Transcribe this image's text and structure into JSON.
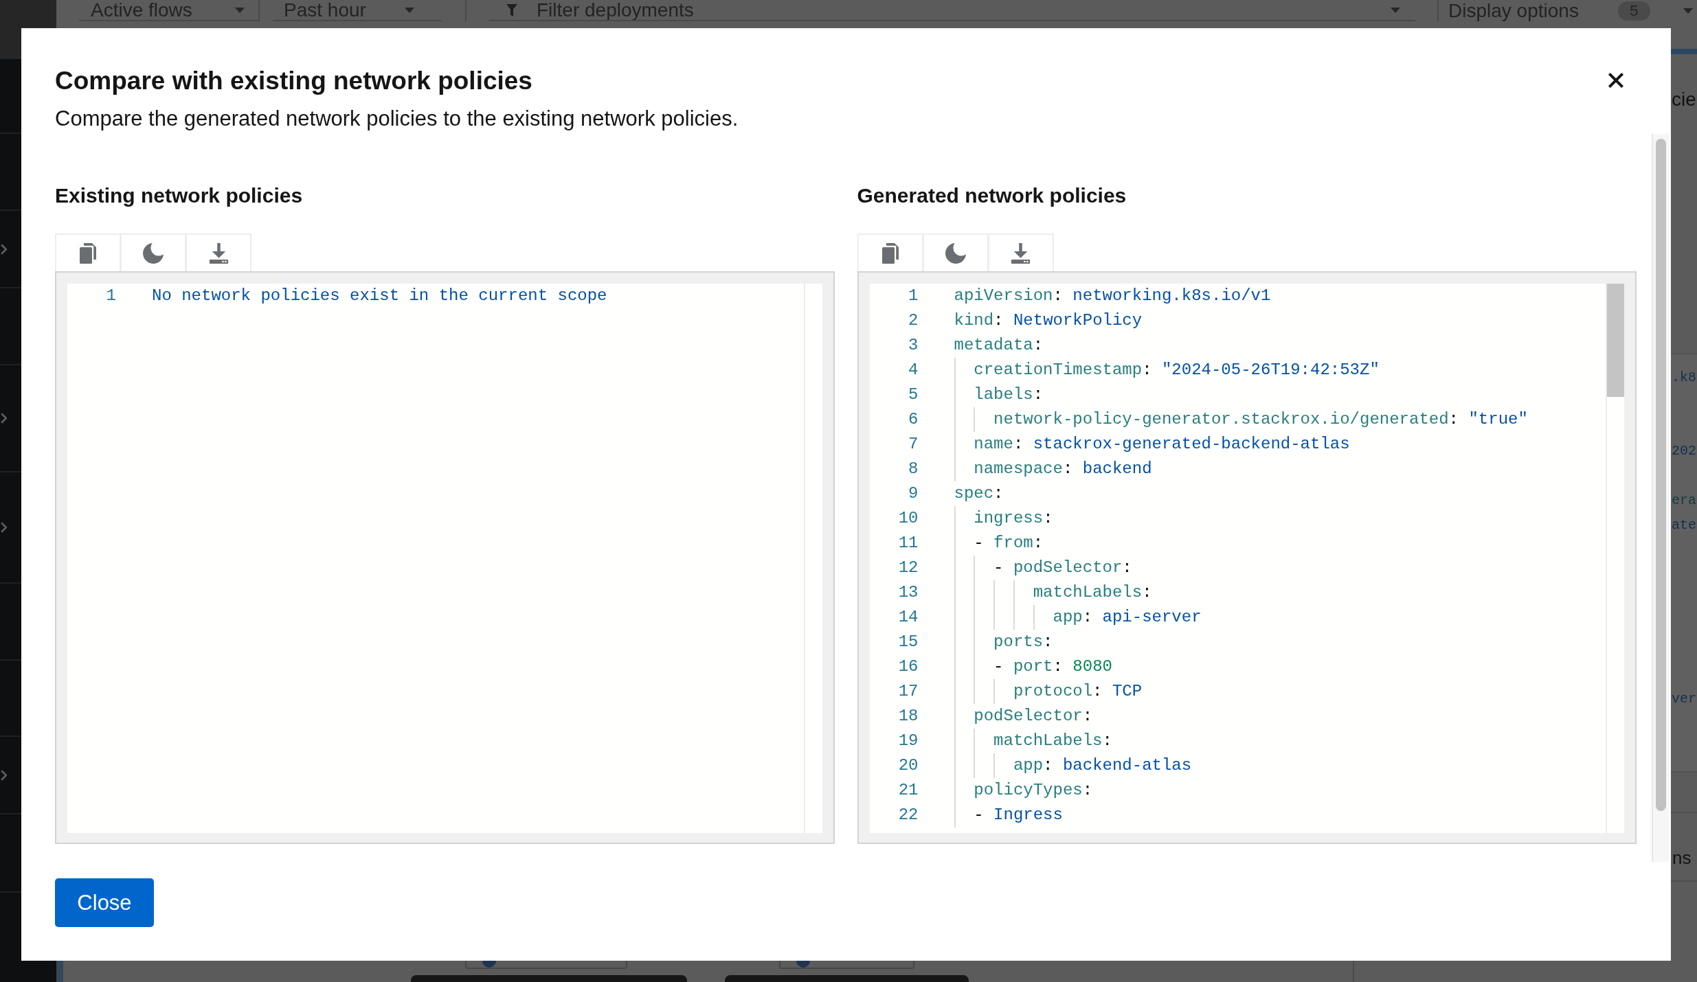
{
  "background": {
    "toolbar": {
      "selects": [
        {
          "label": "Active flows"
        },
        {
          "label": "Past hour"
        }
      ],
      "filter": {
        "placeholder": "Filter deployments"
      },
      "display_options": {
        "label": "Display options",
        "badge": "5"
      }
    },
    "side_panel": [
      {
        "kind": "heading",
        "text": "cie"
      },
      {
        "kind": "code_value",
        "text": ".k8"
      },
      {
        "kind": "code_value",
        "text": "202"
      },
      {
        "kind": "code_key",
        "text": "era"
      },
      {
        "kind": "code_value",
        "text": "ate"
      },
      {
        "kind": "code_value",
        "text": "ver"
      },
      {
        "kind": "button",
        "text": "ns"
      }
    ]
  },
  "modal": {
    "title": "Compare with existing network policies",
    "description": "Compare the generated network policies to the existing network policies.",
    "panes": [
      {
        "heading": "Existing network policies",
        "scrollable": false,
        "lines": [
          {
            "number": "1",
            "text": "No network policies exist in the current scope"
          }
        ]
      },
      {
        "heading": "Generated network policies",
        "scrollable": true,
        "lines": [
          {
            "number": "1",
            "text": "apiVersion: networking.k8s.io/v1"
          },
          {
            "number": "2",
            "text": "kind: NetworkPolicy"
          },
          {
            "number": "3",
            "text": "metadata:"
          },
          {
            "number": "4",
            "text": "  creationTimestamp: \"2024-05-26T19:42:53Z\""
          },
          {
            "number": "5",
            "text": "  labels:"
          },
          {
            "number": "6",
            "text": "    network-policy-generator.stackrox.io/generated: \"true\""
          },
          {
            "number": "7",
            "text": "  name: stackrox-generated-backend-atlas"
          },
          {
            "number": "8",
            "text": "  namespace: backend"
          },
          {
            "number": "9",
            "text": "spec:"
          },
          {
            "number": "10",
            "text": "  ingress:"
          },
          {
            "number": "11",
            "text": "  - from:"
          },
          {
            "number": "12",
            "text": "    - podSelector:"
          },
          {
            "number": "13",
            "text": "        matchLabels:"
          },
          {
            "number": "14",
            "text": "          app: api-server"
          },
          {
            "number": "15",
            "text": "    ports:"
          },
          {
            "number": "16",
            "text": "    - port: 8080"
          },
          {
            "number": "17",
            "text": "      protocol: TCP"
          },
          {
            "number": "18",
            "text": "  podSelector:"
          },
          {
            "number": "19",
            "text": "    matchLabels:"
          },
          {
            "number": "20",
            "text": "      app: backend-atlas"
          },
          {
            "number": "21",
            "text": "  policyTypes:"
          },
          {
            "number": "22",
            "text": "  - Ingress"
          }
        ]
      }
    ],
    "close_button": "Close"
  }
}
